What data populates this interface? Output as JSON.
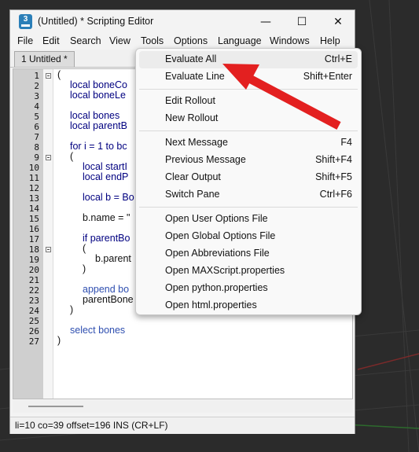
{
  "window": {
    "title": "(Untitled) * Scripting Editor",
    "app_icon_glyph": "3",
    "minimize_glyph": "—",
    "maximize_glyph": "☐",
    "close_glyph": "✕"
  },
  "menubar": {
    "items": [
      "File",
      "Edit",
      "Search",
      "View",
      "Tools",
      "Options",
      "Language",
      "Windows",
      "Help"
    ]
  },
  "tab": {
    "label": "1 Untitled *"
  },
  "editor": {
    "line_numbers": [
      "1",
      "2",
      "3",
      "4",
      "5",
      "6",
      "7",
      "8",
      "9",
      "10",
      "11",
      "12",
      "13",
      "14",
      "15",
      "16",
      "17",
      "18",
      "19",
      "20",
      "21",
      "22",
      "23",
      "24",
      "25",
      "26",
      "27"
    ],
    "lines": [
      "(",
      "local boneCo",
      "local boneLe",
      "",
      "local bones",
      "local parentB",
      "",
      "for i = 1 to bc",
      "(",
      "local startI",
      "local endP",
      "",
      "local b = Bo",
      "",
      "b.name = \"",
      "",
      "if parentBo",
      "(",
      "b.parent",
      ")",
      "",
      "append bo",
      "parentBone",
      ")",
      "",
      "select bones",
      ")"
    ]
  },
  "statusbar": {
    "text": "li=10 co=39 offset=196 INS (CR+LF)"
  },
  "tools_menu": {
    "groups": [
      [
        {
          "label": "Evaluate All",
          "shortcut": "Ctrl+E"
        },
        {
          "label": "Evaluate Line",
          "shortcut": "Shift+Enter"
        }
      ],
      [
        {
          "label": "Edit Rollout",
          "shortcut": ""
        },
        {
          "label": "New Rollout",
          "shortcut": ""
        }
      ],
      [
        {
          "label": "Next Message",
          "shortcut": "F4"
        },
        {
          "label": "Previous Message",
          "shortcut": "Shift+F4"
        },
        {
          "label": "Clear Output",
          "shortcut": "Shift+F5"
        },
        {
          "label": "Switch Pane",
          "shortcut": "Ctrl+F6"
        }
      ],
      [
        {
          "label": "Open User Options File",
          "shortcut": ""
        },
        {
          "label": "Open Global Options File",
          "shortcut": ""
        },
        {
          "label": "Open Abbreviations File",
          "shortcut": ""
        },
        {
          "label": "Open MAXScript.properties",
          "shortcut": ""
        },
        {
          "label": "Open python.properties",
          "shortcut": ""
        },
        {
          "label": "Open html.properties",
          "shortcut": ""
        }
      ]
    ]
  },
  "colors": {
    "annotation_arrow": "#e32020",
    "keyword": "#000080",
    "variable": "#2f4fb0",
    "viewport_bg": "#2b2b2b"
  },
  "icons": {
    "app": "3ds-max-icon",
    "minimize": "minimize-icon",
    "maximize": "maximize-icon",
    "close": "close-icon"
  }
}
